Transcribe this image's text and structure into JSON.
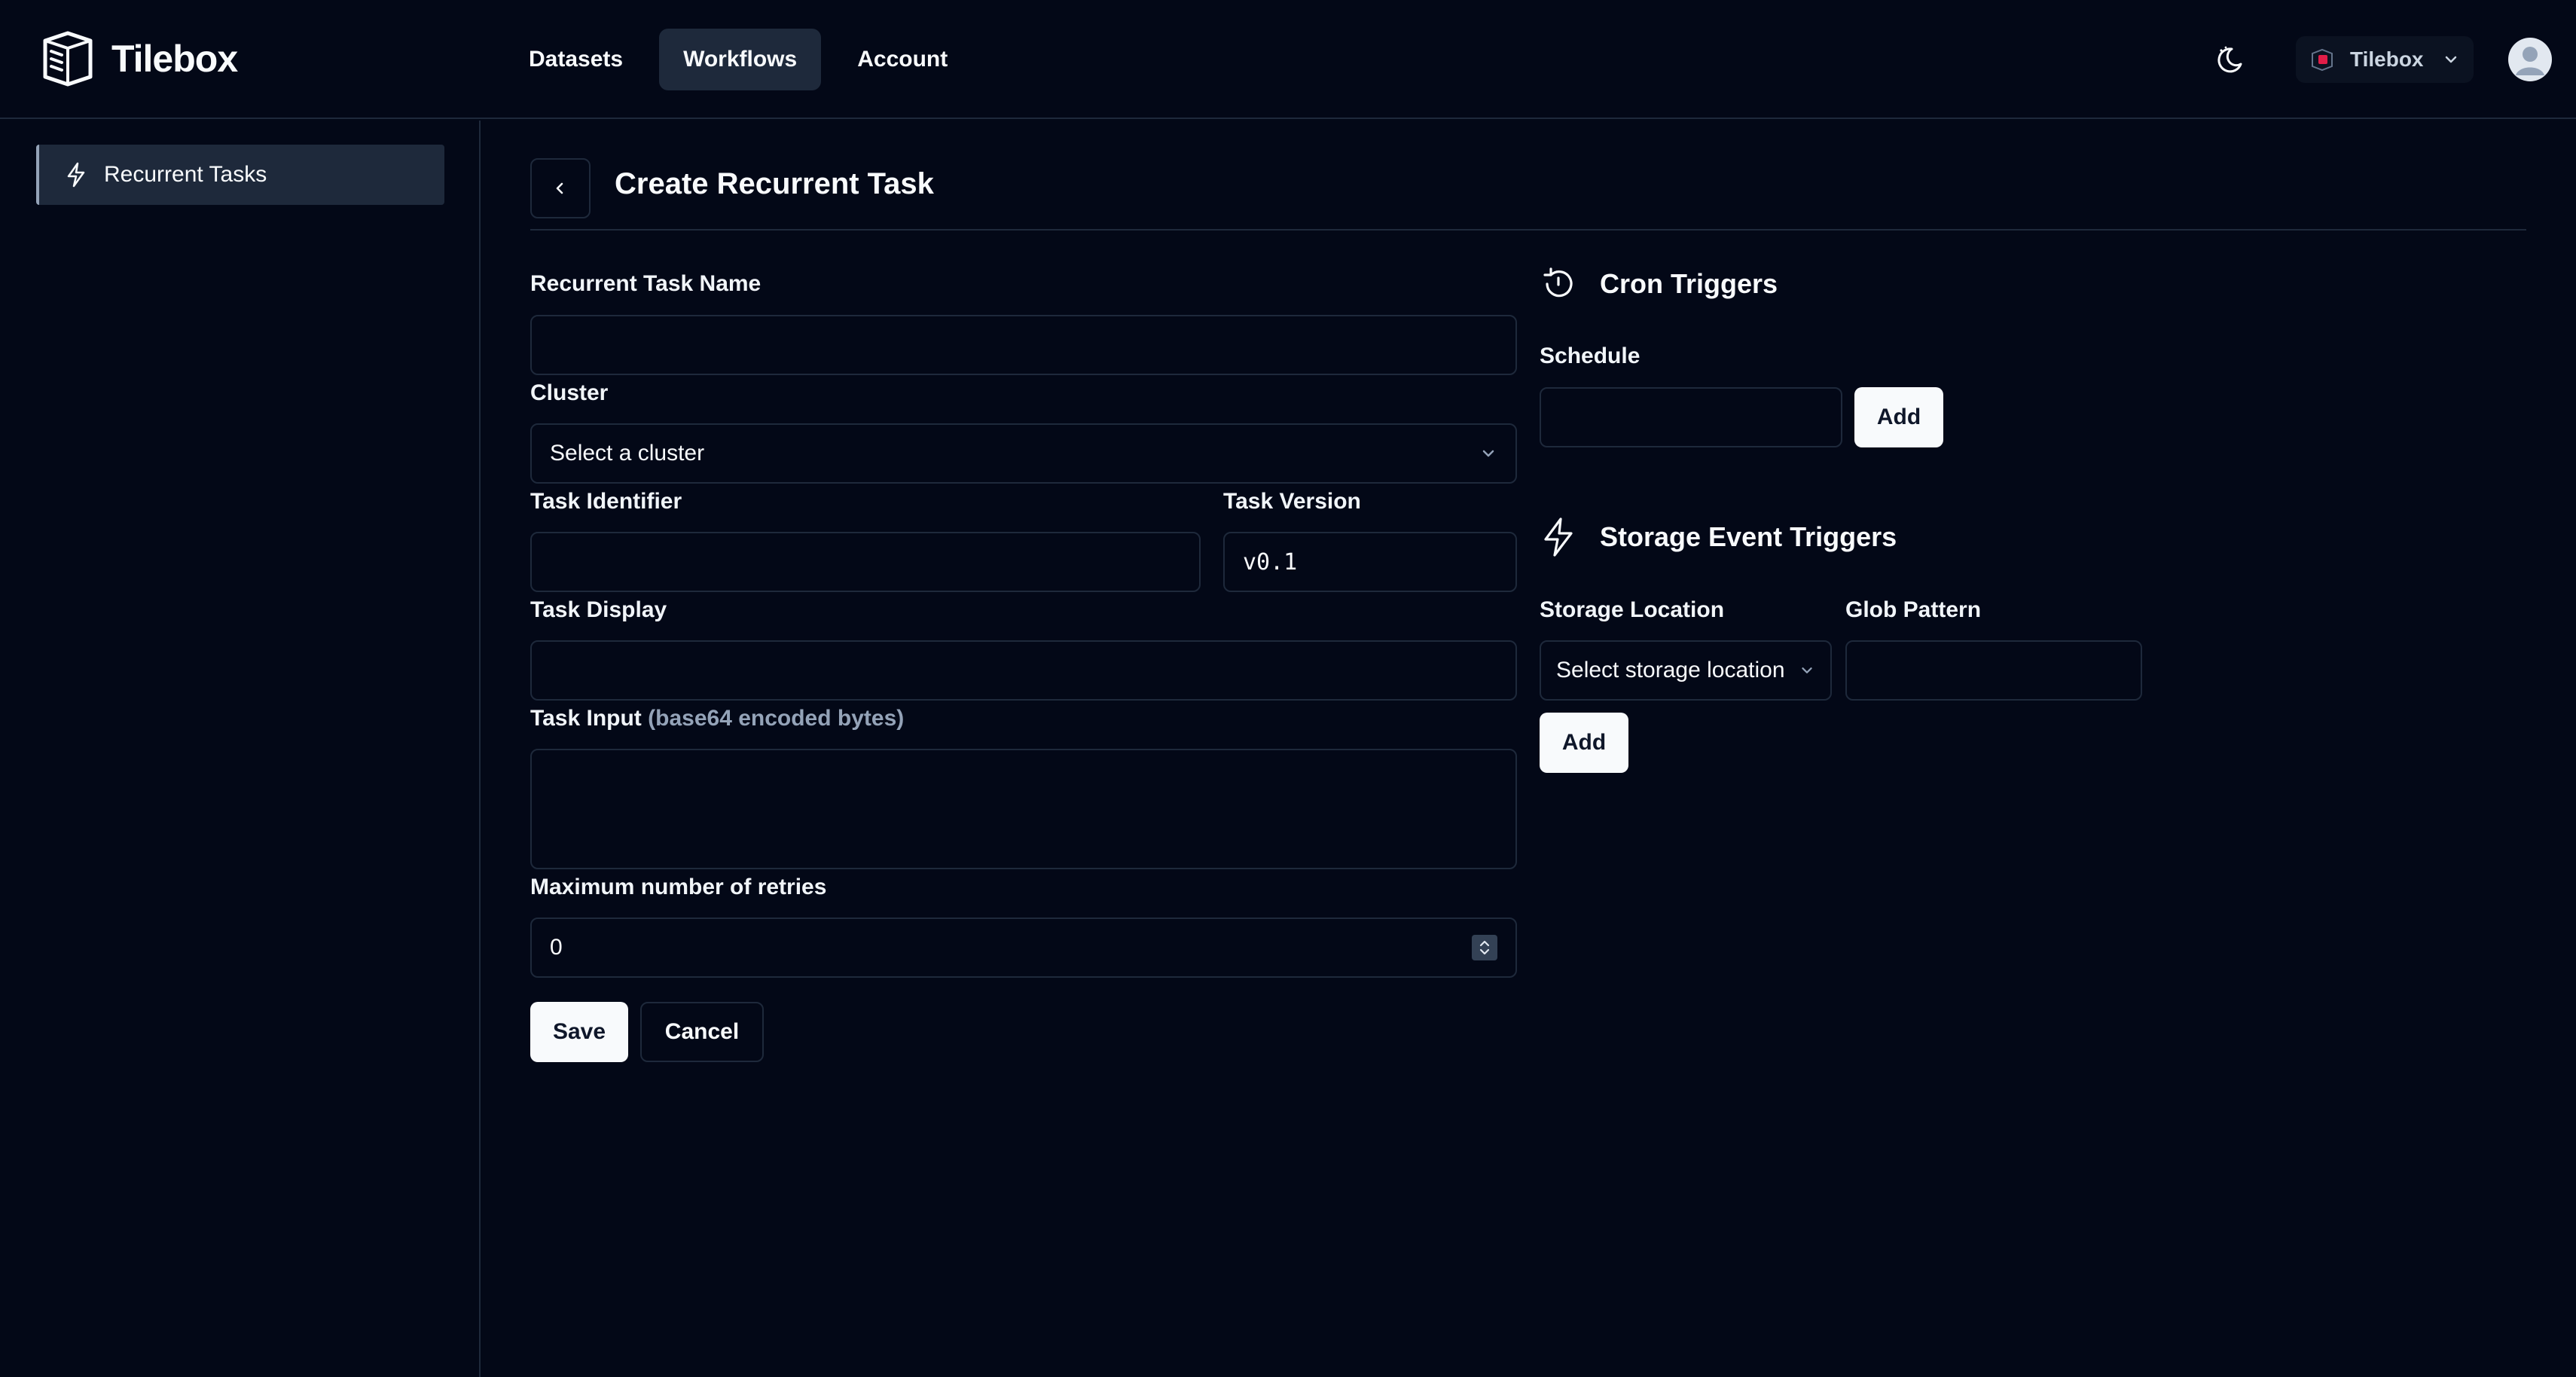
{
  "app": {
    "name": "Tilebox"
  },
  "nav": {
    "items": [
      {
        "label": "Datasets",
        "active": false
      },
      {
        "label": "Workflows",
        "active": true
      },
      {
        "label": "Account",
        "active": false
      }
    ]
  },
  "header": {
    "org_name": "Tilebox"
  },
  "sidebar": {
    "items": [
      {
        "label": "Recurrent Tasks",
        "icon": "lightning-icon",
        "active": true
      }
    ]
  },
  "page": {
    "title": "Create Recurrent Task"
  },
  "form": {
    "task_name": {
      "label": "Recurrent Task Name",
      "value": ""
    },
    "cluster": {
      "label": "Cluster",
      "placeholder": "Select a cluster"
    },
    "task_identifier": {
      "label": "Task Identifier",
      "value": ""
    },
    "task_version": {
      "label": "Task Version",
      "value": "v0.1"
    },
    "task_display": {
      "label": "Task Display",
      "value": ""
    },
    "task_input": {
      "label": "Task Input",
      "hint": "(base64 encoded bytes)",
      "value": ""
    },
    "max_retries": {
      "label": "Maximum number of retries",
      "value": "0"
    },
    "save_label": "Save",
    "cancel_label": "Cancel"
  },
  "cron": {
    "title": "Cron Triggers",
    "schedule_label": "Schedule",
    "schedule_value": "",
    "add_label": "Add"
  },
  "storage": {
    "title": "Storage Event Triggers",
    "location_label": "Storage Location",
    "location_placeholder": "Select storage location",
    "glob_label": "Glob Pattern",
    "glob_value": "",
    "add_label": "Add"
  },
  "colors": {
    "background": "#030817",
    "border": "#1e293b",
    "active_bg": "#1e293b",
    "primary_button": "#f8fafc",
    "text": "#f8fafc",
    "muted": "#94a3b8"
  }
}
